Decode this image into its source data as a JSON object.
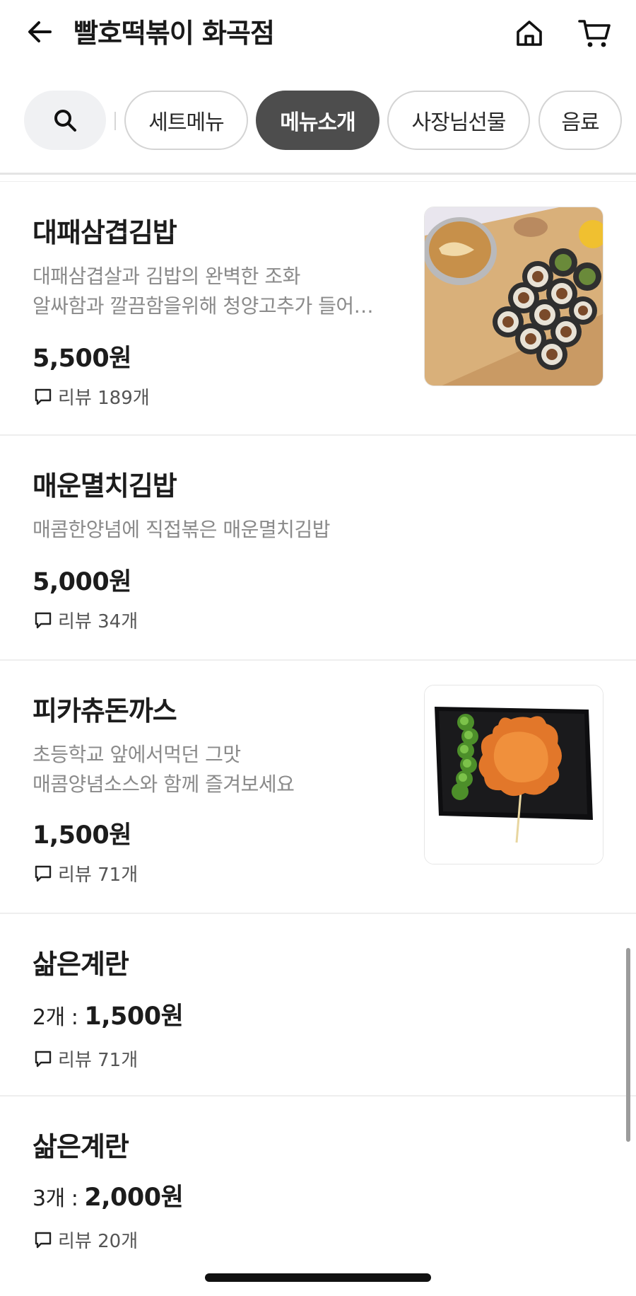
{
  "header": {
    "title": "빨호떡볶이 화곡점"
  },
  "tabs": [
    {
      "label": "세트메뉴",
      "active": false
    },
    {
      "label": "메뉴소개",
      "active": true
    },
    {
      "label": "사장님선물",
      "active": false
    },
    {
      "label": "음료",
      "active": false
    }
  ],
  "menu_items": [
    {
      "name": "대패삼겹김밥",
      "desc_line1": "대패삼겹살과 김밥의 완벽한 조화",
      "desc_line2": "알싸함과 깔끔함을위해 청양고추가 들어…",
      "price": "5,500원",
      "review": "리뷰 189개"
    },
    {
      "name": "매운멸치김밥",
      "desc_line1": "매콤한양념에 직접볶은 매운멸치김밥",
      "price": "5,000원",
      "review": "리뷰 34개"
    },
    {
      "name": "피카츄돈까스",
      "desc_line1": "초등학교 앞에서먹던 그맛",
      "desc_line2": "매콤양념소스와 함께 즐겨보세요",
      "price": "1,500원",
      "review": "리뷰 71개"
    },
    {
      "name": "삶은계란",
      "qty": "2개 : ",
      "price": "1,500원",
      "review": "리뷰 71개"
    },
    {
      "name": "삶은계란",
      "qty": "3개 : ",
      "price": "2,000원",
      "review": "리뷰 20개"
    }
  ],
  "icons": {
    "back": "arrow-left-icon",
    "home": "home-icon",
    "cart": "cart-icon",
    "search": "search-icon",
    "review": "speech-bubble-icon"
  },
  "colors": {
    "active_tab": "#4d4d4d",
    "search_chip": "#f0f1f3",
    "description": "#8a8a8a"
  }
}
